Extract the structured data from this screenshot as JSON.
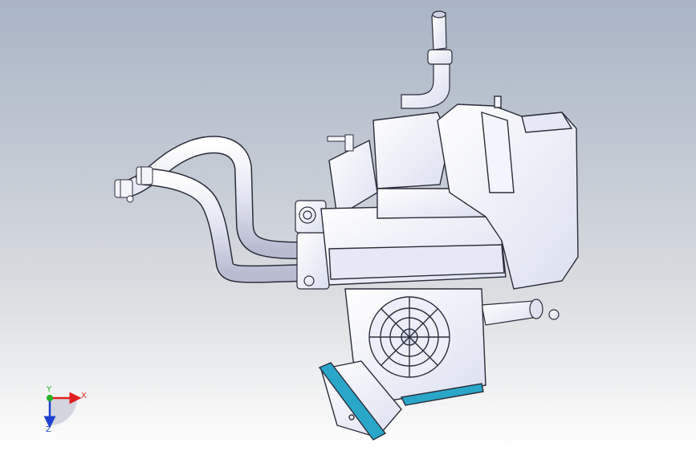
{
  "viewport": {
    "background_top": "#a9b4c5",
    "background_bottom": "#ffffff",
    "model_fill": "#eef0fb",
    "model_stroke": "#2b2d3a",
    "accent_blue": "#2aa6c9"
  },
  "triad": {
    "x_label": "X",
    "y_label": "Y",
    "z_label": "Z",
    "x_color": "#e02020",
    "y_color": "#22b022",
    "z_color": "#2040d0"
  }
}
